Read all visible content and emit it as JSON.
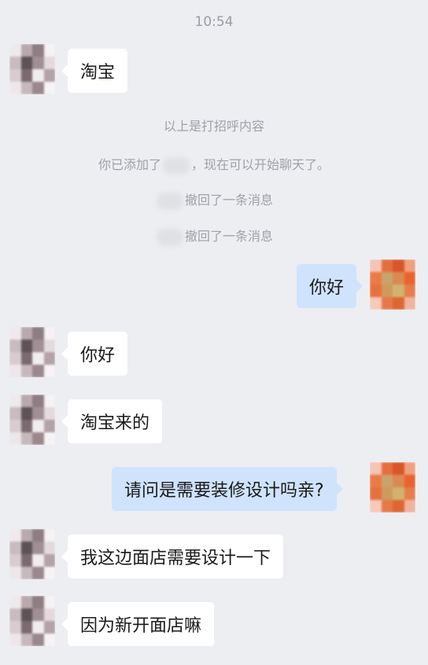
{
  "header": {
    "time": "10:54"
  },
  "system": {
    "greeting_note": "以上是打招呼内容",
    "added_prefix": "你已添加了",
    "added_suffix": "，现在可以开始聊天了。",
    "recall_1": "撤回了一条消息",
    "recall_2": "撤回了一条消息"
  },
  "messages": [
    {
      "side": "in",
      "text": "淘宝"
    },
    {
      "side": "out",
      "text": "你好"
    },
    {
      "side": "in",
      "text": "你好"
    },
    {
      "side": "in",
      "text": "淘宝来的"
    },
    {
      "side": "out",
      "text": "请问是需要装修设计吗亲?"
    },
    {
      "side": "in",
      "text": "我这边面店需要设计一下"
    },
    {
      "side": "in",
      "text": "因为新开面店嘛"
    }
  ],
  "colors": {
    "background": "#edeef2",
    "incoming_bubble": "#ffffff",
    "outgoing_bubble": "#cfe3fd",
    "system_text": "#9fa1a7"
  },
  "avatars": {
    "contact_icon": "blurred-contact-avatar",
    "self_icon": "blurred-self-avatar"
  }
}
